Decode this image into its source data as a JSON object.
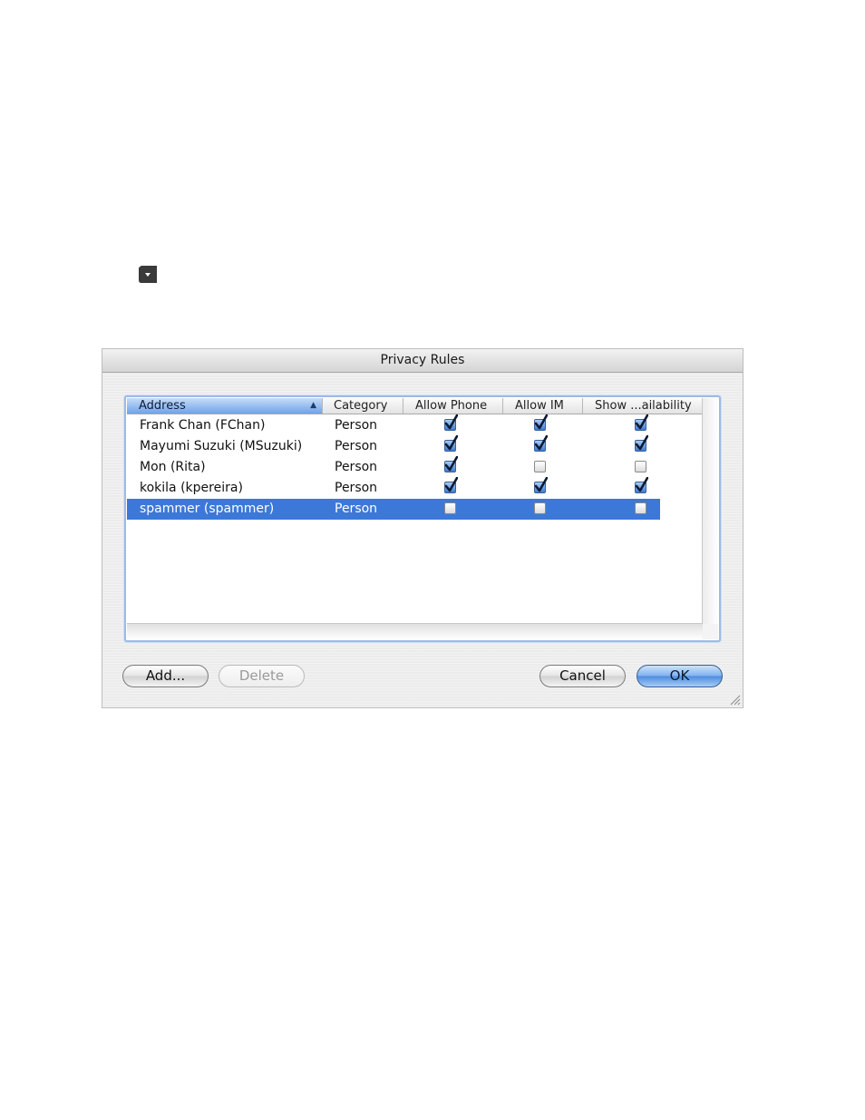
{
  "window": {
    "title": "Privacy Rules"
  },
  "table": {
    "columns": [
      "Address",
      "Category",
      "Allow Phone",
      "Allow IM",
      "Show ...ailability"
    ],
    "sort_column": "Address",
    "rows": [
      {
        "address": "Frank Chan (FChan)",
        "category": "Person",
        "allow_phone": true,
        "allow_im": true,
        "show_availability": true,
        "selected": false
      },
      {
        "address": "Mayumi Suzuki (MSuzuki)",
        "category": "Person",
        "allow_phone": true,
        "allow_im": true,
        "show_availability": true,
        "selected": false
      },
      {
        "address": "Mon (Rita)",
        "category": "Person",
        "allow_phone": true,
        "allow_im": false,
        "show_availability": false,
        "selected": false
      },
      {
        "address": "kokila (kpereira)",
        "category": "Person",
        "allow_phone": true,
        "allow_im": true,
        "show_availability": true,
        "selected": false
      },
      {
        "address": "spammer (spammer)",
        "category": "Person",
        "allow_phone": false,
        "allow_im": false,
        "show_availability": false,
        "selected": true
      }
    ]
  },
  "buttons": {
    "add": "Add...",
    "delete": "Delete",
    "cancel": "Cancel",
    "ok": "OK"
  },
  "icons": {
    "menu": "dropdown-menu-icon",
    "sort": "sort-ascending-icon",
    "resize": "resize-grip-icon"
  },
  "colors": {
    "selection": "#3c78d8",
    "checkbox_checked": "#3d7bd4",
    "sorted_header": "#6fa3ea"
  }
}
